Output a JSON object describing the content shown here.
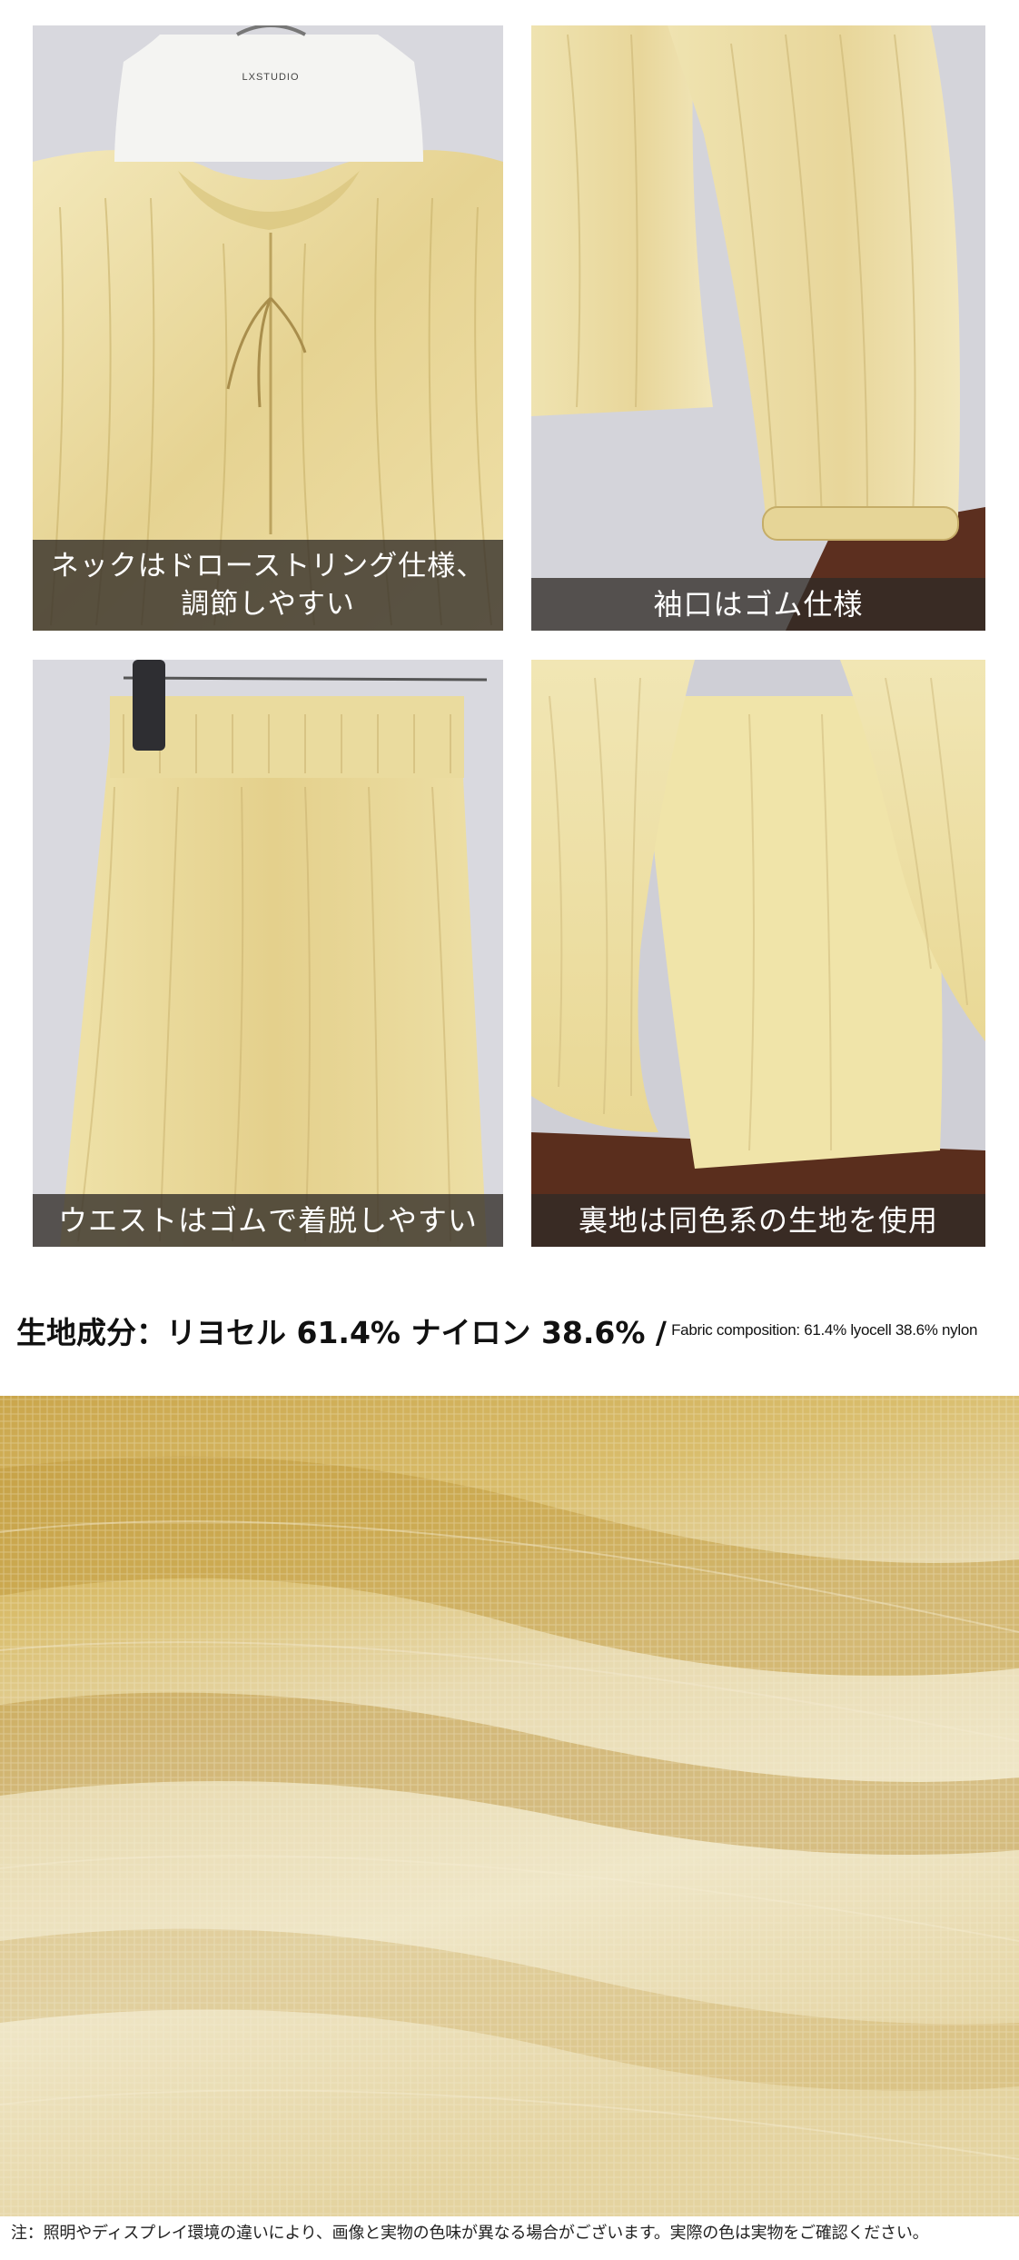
{
  "panels": [
    {
      "caption_lines": [
        "ネックはドローストリング仕様、",
        "調節しやすい"
      ]
    },
    {
      "caption_lines": [
        "袖口はゴム仕様"
      ]
    },
    {
      "caption_lines": [
        "ウエストはゴムで着脱しやすい"
      ]
    },
    {
      "caption_lines": [
        "裏地は同色系の生地を使用"
      ]
    }
  ],
  "hanger_brand": "LXSTUDIO",
  "composition": {
    "jp": "生地成分：リヨセル 61.4% ナイロン 38.6% /",
    "en": "Fabric composition: 61.4% lyocell 38.6% nylon"
  },
  "note": "注：照明やディスプレイ環境の違いにより、画像と実物の色味が異なる場合がございます。実際の色は実物をご確認ください。",
  "colors": {
    "fabric_light": "#efe3b0",
    "fabric_mid": "#e2cf8a",
    "fabric_dark": "#b89a4a",
    "background_wall": "#d6d6dc",
    "wood": "#6a3a26",
    "caption_bg": "#302a26"
  }
}
